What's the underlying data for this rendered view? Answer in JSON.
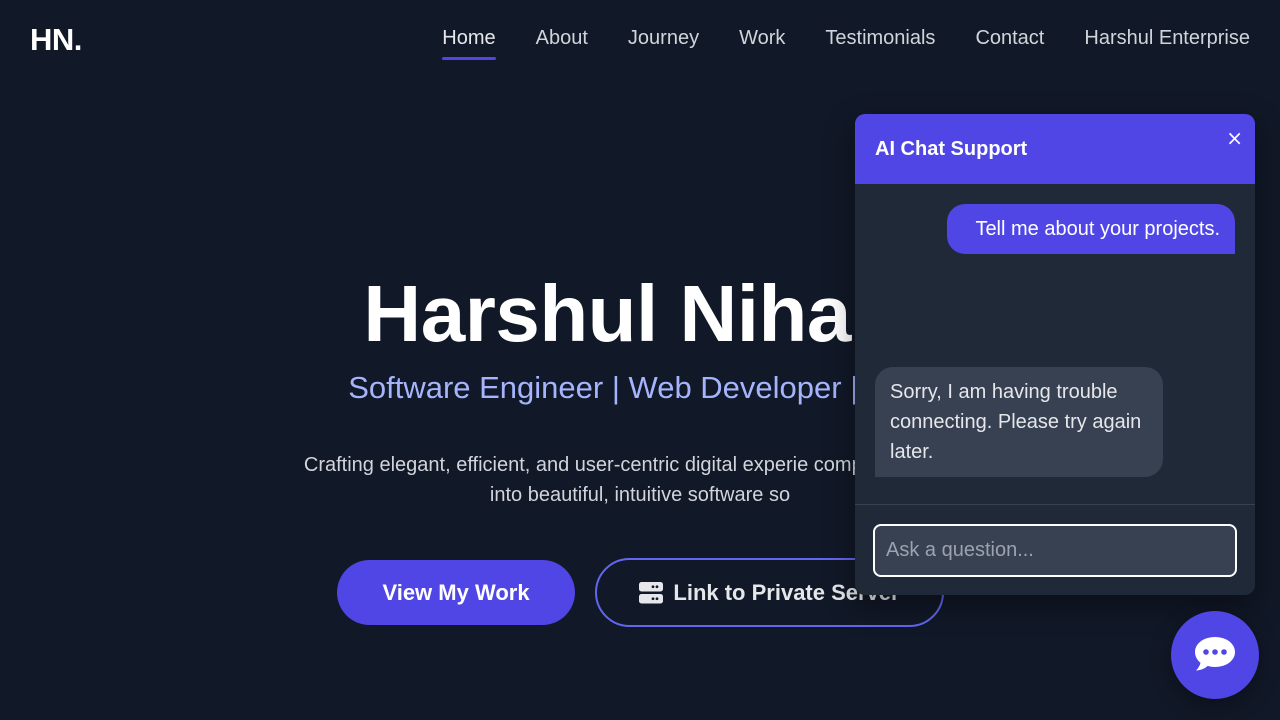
{
  "header": {
    "logo": "HN.",
    "nav": [
      {
        "label": "Home",
        "active": true
      },
      {
        "label": "About",
        "active": false
      },
      {
        "label": "Journey",
        "active": false
      },
      {
        "label": "Work",
        "active": false
      },
      {
        "label": "Testimonials",
        "active": false
      },
      {
        "label": "Contact",
        "active": false
      },
      {
        "label": "Harshul Enterprise",
        "active": false
      }
    ]
  },
  "hero": {
    "title": "Harshul Nihala",
    "subtitle": "Software Engineer | Web Developer | Tech",
    "description": "Crafting elegant, efficient, and user-centric digital experie complex problems into beautiful, intuitive software so",
    "primary_button": "View My Work",
    "secondary_button": "Link to Private Server",
    "secondary_icon": "server-icon"
  },
  "chat": {
    "title": "AI Chat Support",
    "close_label": "×",
    "messages": [
      {
        "role": "user",
        "text": "Tell me about your projects."
      },
      {
        "role": "bot",
        "text": "Sorry, I am having trouble connecting. Please try again later."
      }
    ],
    "input_placeholder": "Ask a question...",
    "input_value": "",
    "fab_icon": "chat-bubble-icon"
  },
  "colors": {
    "background": "#111827",
    "accent": "#4f46e5",
    "subtitle": "#a5b4fc",
    "panel": "#1f2937",
    "bot_bubble": "#374151"
  }
}
